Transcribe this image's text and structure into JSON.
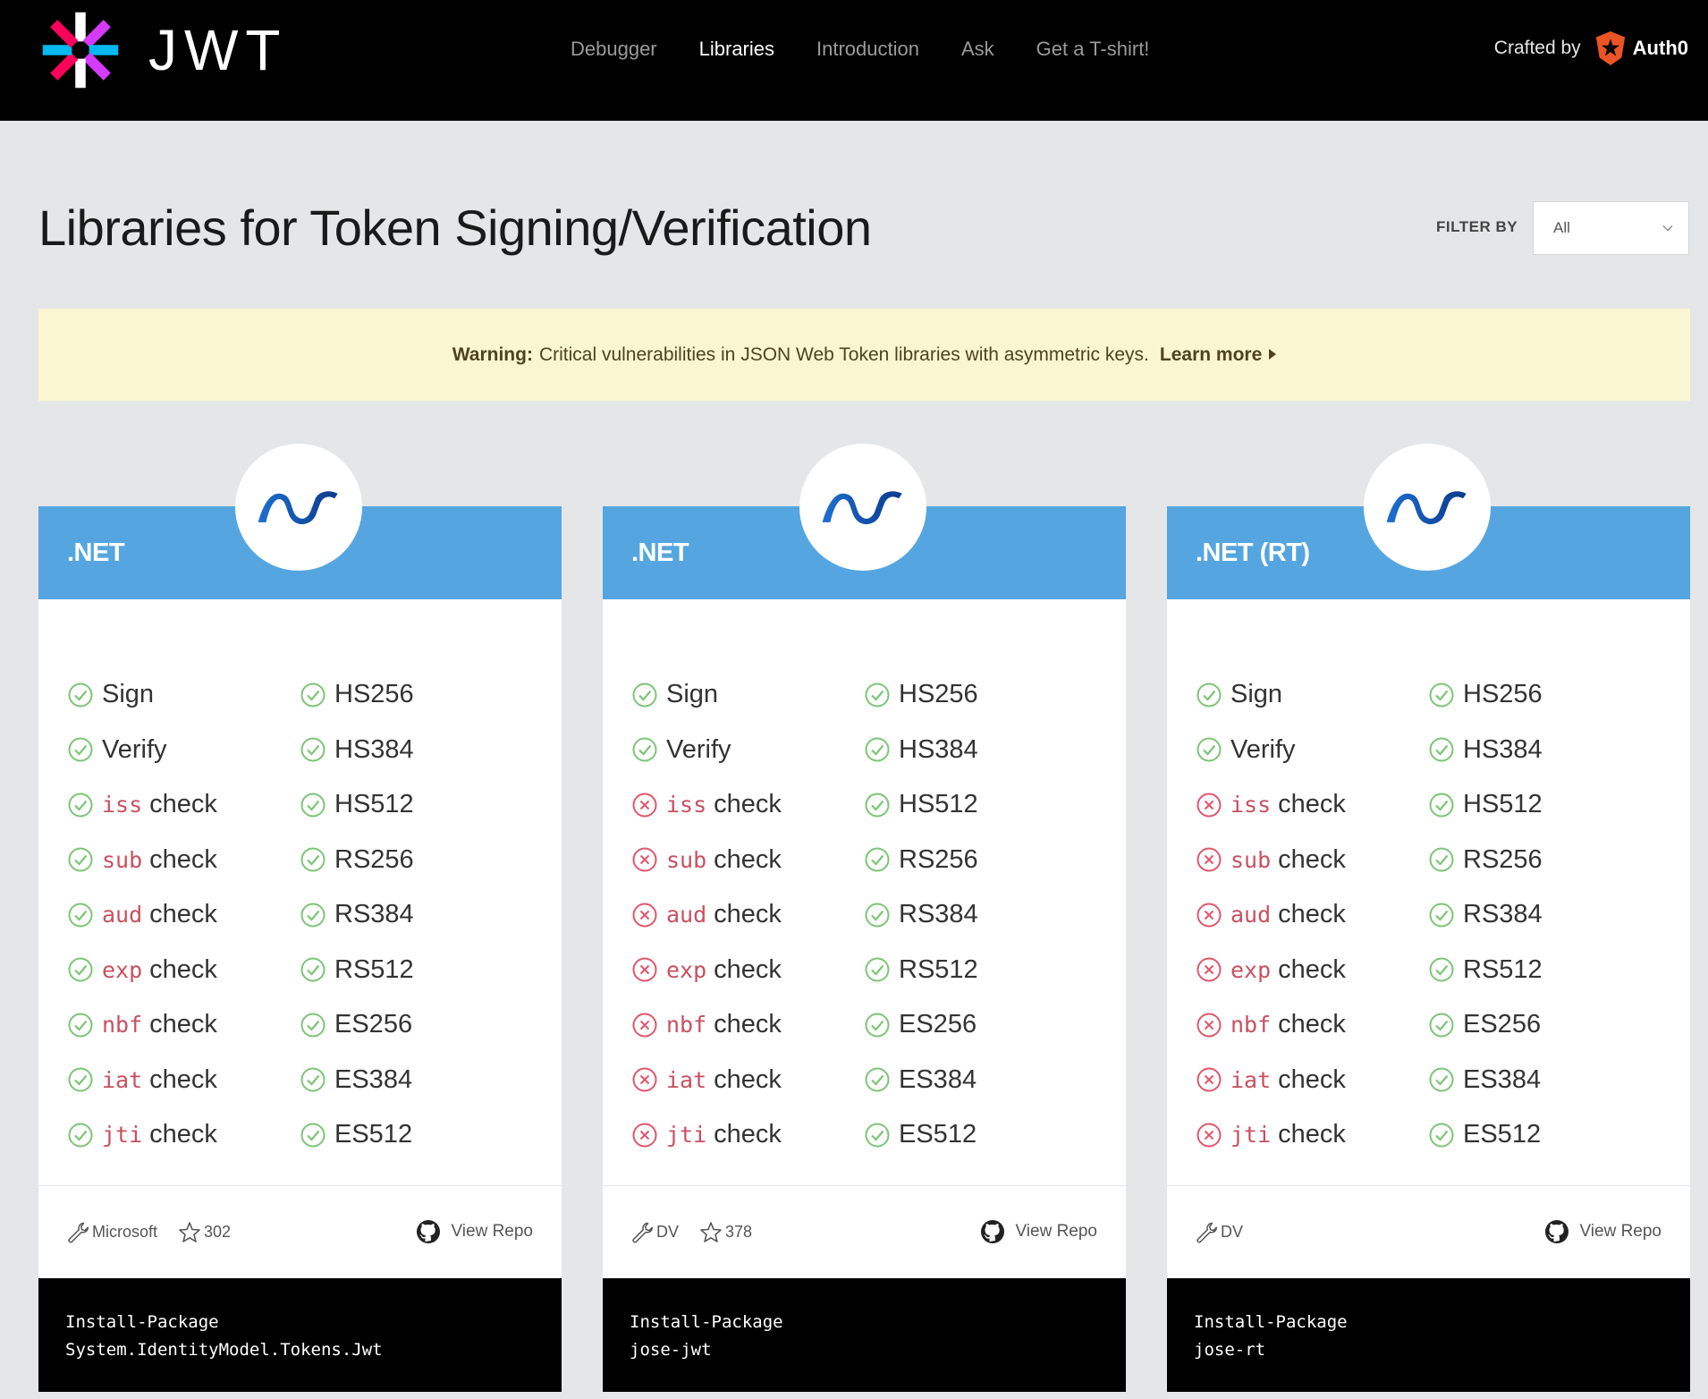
{
  "header": {
    "logo_text": "JWT",
    "nav": [
      {
        "label": "Debugger",
        "active": false
      },
      {
        "label": "Libraries",
        "active": true
      },
      {
        "label": "Introduction",
        "active": false
      },
      {
        "label": "Ask",
        "active": false
      },
      {
        "label": "Get a T-shirt!",
        "active": false
      }
    ],
    "crafted_by": "Crafted by",
    "brand": "Auth0"
  },
  "page": {
    "title": "Libraries for Token Signing/Verification",
    "filter_label": "FILTER BY",
    "filter_value": "All"
  },
  "warning": {
    "label": "Warning:",
    "text": "Critical vulnerabilities in JSON Web Token libraries with asymmetric keys.",
    "link": "Learn more"
  },
  "cards": [
    {
      "title": ".NET",
      "author": "Microsoft",
      "stars": "302",
      "repo_label": "View Repo",
      "install": [
        "Install-Package",
        "System.IdentityModel.Tokens.Jwt"
      ],
      "features": [
        {
          "code": "",
          "label": "Sign",
          "ok": true
        },
        {
          "code": "",
          "label": "Verify",
          "ok": true
        },
        {
          "code": "iss",
          "label": "check",
          "ok": true
        },
        {
          "code": "sub",
          "label": "check",
          "ok": true
        },
        {
          "code": "aud",
          "label": "check",
          "ok": true
        },
        {
          "code": "exp",
          "label": "check",
          "ok": true
        },
        {
          "code": "nbf",
          "label": "check",
          "ok": true
        },
        {
          "code": "iat",
          "label": "check",
          "ok": true
        },
        {
          "code": "jti",
          "label": "check",
          "ok": true
        }
      ],
      "algorithms": [
        {
          "label": "HS256",
          "ok": true
        },
        {
          "label": "HS384",
          "ok": true
        },
        {
          "label": "HS512",
          "ok": true
        },
        {
          "label": "RS256",
          "ok": true
        },
        {
          "label": "RS384",
          "ok": true
        },
        {
          "label": "RS512",
          "ok": true
        },
        {
          "label": "ES256",
          "ok": true
        },
        {
          "label": "ES384",
          "ok": true
        },
        {
          "label": "ES512",
          "ok": true
        }
      ]
    },
    {
      "title": ".NET",
      "author": "DV",
      "stars": "378",
      "repo_label": "View Repo",
      "install": [
        "Install-Package",
        "jose-jwt"
      ],
      "features": [
        {
          "code": "",
          "label": "Sign",
          "ok": true
        },
        {
          "code": "",
          "label": "Verify",
          "ok": true
        },
        {
          "code": "iss",
          "label": "check",
          "ok": false
        },
        {
          "code": "sub",
          "label": "check",
          "ok": false
        },
        {
          "code": "aud",
          "label": "check",
          "ok": false
        },
        {
          "code": "exp",
          "label": "check",
          "ok": false
        },
        {
          "code": "nbf",
          "label": "check",
          "ok": false
        },
        {
          "code": "iat",
          "label": "check",
          "ok": false
        },
        {
          "code": "jti",
          "label": "check",
          "ok": false
        }
      ],
      "algorithms": [
        {
          "label": "HS256",
          "ok": true
        },
        {
          "label": "HS384",
          "ok": true
        },
        {
          "label": "HS512",
          "ok": true
        },
        {
          "label": "RS256",
          "ok": true
        },
        {
          "label": "RS384",
          "ok": true
        },
        {
          "label": "RS512",
          "ok": true
        },
        {
          "label": "ES256",
          "ok": true
        },
        {
          "label": "ES384",
          "ok": true
        },
        {
          "label": "ES512",
          "ok": true
        }
      ]
    },
    {
      "title": ".NET (RT)",
      "author": "DV",
      "stars": "",
      "repo_label": "View Repo",
      "install": [
        "Install-Package",
        "jose-rt"
      ],
      "features": [
        {
          "code": "",
          "label": "Sign",
          "ok": true
        },
        {
          "code": "",
          "label": "Verify",
          "ok": true
        },
        {
          "code": "iss",
          "label": "check",
          "ok": false
        },
        {
          "code": "sub",
          "label": "check",
          "ok": false
        },
        {
          "code": "aud",
          "label": "check",
          "ok": false
        },
        {
          "code": "exp",
          "label": "check",
          "ok": false
        },
        {
          "code": "nbf",
          "label": "check",
          "ok": false
        },
        {
          "code": "iat",
          "label": "check",
          "ok": false
        },
        {
          "code": "jti",
          "label": "check",
          "ok": false
        }
      ],
      "algorithms": [
        {
          "label": "HS256",
          "ok": true
        },
        {
          "label": "HS384",
          "ok": true
        },
        {
          "label": "HS512",
          "ok": true
        },
        {
          "label": "RS256",
          "ok": true
        },
        {
          "label": "RS384",
          "ok": true
        },
        {
          "label": "RS512",
          "ok": true
        },
        {
          "label": "ES256",
          "ok": true
        },
        {
          "label": "ES384",
          "ok": true
        },
        {
          "label": "ES512",
          "ok": true
        }
      ]
    }
  ],
  "colors": {
    "card_header": "#55a6e0",
    "check_green": "#7cc576",
    "cross_red": "#e0566c",
    "code_red": "#c9505f",
    "warning_bg": "#fbf6d2"
  }
}
